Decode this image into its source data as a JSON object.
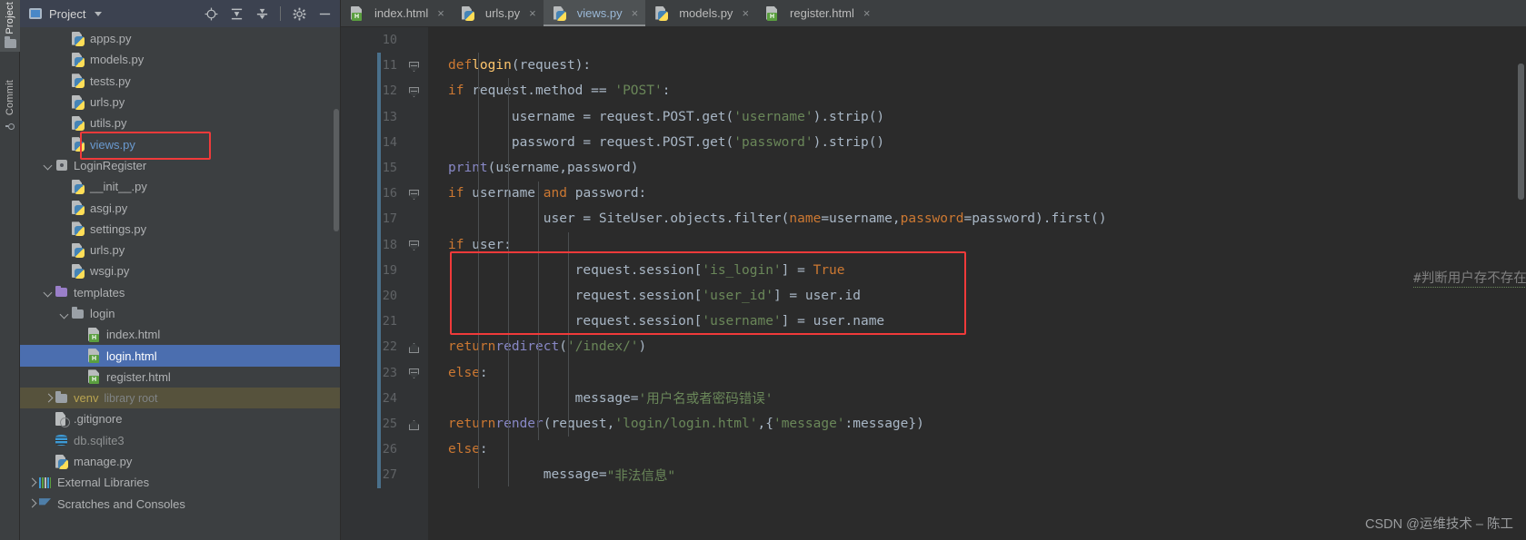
{
  "toolstrip": {
    "items": [
      {
        "label": "Project",
        "icon": "folder-icon",
        "active": true
      },
      {
        "label": "Commit",
        "icon": "commit-icon",
        "active": false
      }
    ]
  },
  "project_panel": {
    "header": {
      "title": "Project",
      "dropdown_icon": "chevron-down-icon",
      "buttons": [
        {
          "name": "locate-icon",
          "glyph": "⊕"
        },
        {
          "name": "expand-all-icon",
          "glyph": "⤓"
        },
        {
          "name": "collapse-all-icon",
          "glyph": "⤒"
        },
        {
          "name": "settings-gear-icon",
          "glyph": "⚙"
        },
        {
          "name": "hide-panel-icon",
          "glyph": "−"
        }
      ]
    },
    "tree": [
      {
        "label": "apps.py",
        "icon": "python-file-icon",
        "indent": 3,
        "arrow": "none",
        "state": "normal"
      },
      {
        "label": "models.py",
        "icon": "python-file-icon",
        "indent": 3,
        "arrow": "none",
        "state": "normal"
      },
      {
        "label": "tests.py",
        "icon": "python-file-icon",
        "indent": 3,
        "arrow": "none",
        "state": "normal"
      },
      {
        "label": "urls.py",
        "icon": "python-file-icon",
        "indent": 3,
        "arrow": "none",
        "state": "normal"
      },
      {
        "label": "utils.py",
        "icon": "python-file-icon",
        "indent": 3,
        "arrow": "none",
        "state": "normal"
      },
      {
        "label": "views.py",
        "icon": "python-file-icon",
        "indent": 3,
        "arrow": "none",
        "state": "opened"
      },
      {
        "label": "LoginRegister",
        "icon": "package-icon",
        "indent": 2,
        "arrow": "down",
        "state": "normal"
      },
      {
        "label": "__init__.py",
        "icon": "python-file-icon",
        "indent": 3,
        "arrow": "none",
        "state": "normal"
      },
      {
        "label": "asgi.py",
        "icon": "python-file-icon",
        "indent": 3,
        "arrow": "none",
        "state": "normal"
      },
      {
        "label": "settings.py",
        "icon": "python-file-icon",
        "indent": 3,
        "arrow": "none",
        "state": "normal"
      },
      {
        "label": "urls.py",
        "icon": "python-file-icon",
        "indent": 3,
        "arrow": "none",
        "state": "normal"
      },
      {
        "label": "wsgi.py",
        "icon": "python-file-icon",
        "indent": 3,
        "arrow": "none",
        "state": "normal"
      },
      {
        "label": "templates",
        "icon": "folder-purple-icon",
        "indent": 2,
        "arrow": "down",
        "state": "normal"
      },
      {
        "label": "login",
        "icon": "folder-icon",
        "indent": 3,
        "arrow": "down",
        "state": "normal"
      },
      {
        "label": "index.html",
        "icon": "html-file-icon",
        "indent": 4,
        "arrow": "none",
        "state": "normal"
      },
      {
        "label": "login.html",
        "icon": "html-file-icon",
        "indent": 4,
        "arrow": "none",
        "state": "selected"
      },
      {
        "label": "register.html",
        "icon": "html-file-icon",
        "indent": 4,
        "arrow": "none",
        "state": "normal"
      },
      {
        "label": "venv",
        "icon": "folder-icon",
        "indent": 2,
        "arrow": "right",
        "state": "highlight",
        "suffix": "library root"
      },
      {
        "label": ".gitignore",
        "icon": "gitignore-icon",
        "indent": 2,
        "arrow": "none",
        "state": "normal"
      },
      {
        "label": "db.sqlite3",
        "icon": "database-icon",
        "indent": 2,
        "arrow": "none",
        "state": "dim"
      },
      {
        "label": "manage.py",
        "icon": "python-file-icon",
        "indent": 2,
        "arrow": "none",
        "state": "normal"
      },
      {
        "label": "External Libraries",
        "icon": "external-libs-icon",
        "indent": 1,
        "arrow": "right",
        "state": "normal"
      },
      {
        "label": "Scratches and Consoles",
        "icon": "scratch-icon",
        "indent": 1,
        "arrow": "right",
        "state": "normal"
      }
    ]
  },
  "tabs": [
    {
      "label": "index.html",
      "icon": "html-file-icon",
      "active": false,
      "close": "×"
    },
    {
      "label": "urls.py",
      "icon": "python-file-icon",
      "active": false,
      "close": "×"
    },
    {
      "label": "views.py",
      "icon": "python-file-icon",
      "active": true,
      "close": "×"
    },
    {
      "label": "models.py",
      "icon": "python-file-icon",
      "active": false,
      "close": "×"
    },
    {
      "label": "register.html",
      "icon": "html-file-icon",
      "active": false,
      "close": "×"
    }
  ],
  "editor": {
    "line_numbers": [
      "10",
      "11",
      "12",
      "13",
      "14",
      "15",
      "16",
      "17",
      "18",
      "19",
      "20",
      "21",
      "22",
      "23",
      "24",
      "25",
      "26",
      "27"
    ],
    "gutter_html_icon_line": "25",
    "right_comment": "#判断用户存不存在",
    "lines": [
      {
        "n": "10",
        "text": ""
      },
      {
        "n": "11",
        "text": "def login(request):"
      },
      {
        "n": "12",
        "text": "    if request.method == 'POST':"
      },
      {
        "n": "13",
        "text": "        username = request.POST.get('username').strip()"
      },
      {
        "n": "14",
        "text": "        password = request.POST.get('password').strip()"
      },
      {
        "n": "15",
        "text": "        print(username,password)"
      },
      {
        "n": "16",
        "text": "        if username and password:"
      },
      {
        "n": "17",
        "text": "            user = SiteUser.objects.filter(name=username,password=password).first()"
      },
      {
        "n": "18",
        "text": "            if user:"
      },
      {
        "n": "19",
        "text": "                request.session['is_login'] = True"
      },
      {
        "n": "20",
        "text": "                request.session['user_id'] = user.id"
      },
      {
        "n": "21",
        "text": "                request.session['username'] = user.name"
      },
      {
        "n": "22",
        "text": "                return redirect('/index/')"
      },
      {
        "n": "23",
        "text": "            else:"
      },
      {
        "n": "24",
        "text": "                message='用户名或者密码错误'"
      },
      {
        "n": "25",
        "text": "                return render(request,'login/login.html',{'message':message})"
      },
      {
        "n": "26",
        "text": "        else:"
      },
      {
        "n": "27",
        "text": "            message=\"非法信息\""
      }
    ]
  },
  "annotations": {
    "tree_redbox_label": "views.py",
    "code_redbox_label": "session assignment block",
    "box_color": "#f03a3a"
  },
  "watermark": "CSDN @运维技术 – 陈工"
}
